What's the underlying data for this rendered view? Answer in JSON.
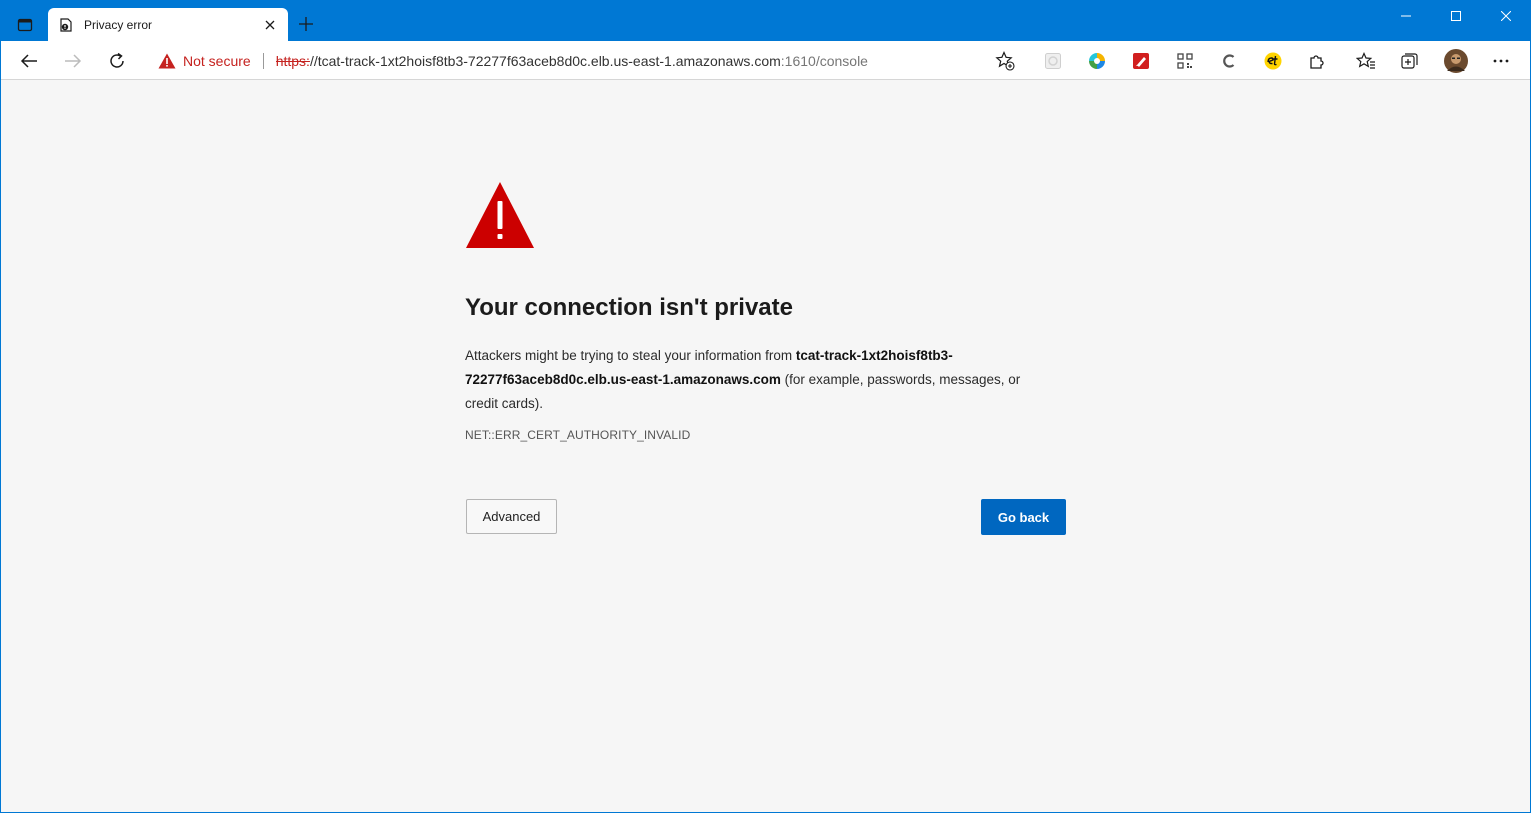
{
  "window": {
    "tab_title": "Privacy error",
    "accent_color": "#0078d4"
  },
  "toolbar": {
    "security_label": "Not secure",
    "url_scheme": "https:",
    "url_sep": "//",
    "url_host": "tcat-track-1xt2hoisf8tb3-72277f63aceb8d0c.elb.us-east-1.amazonaws.com",
    "url_path": ":1610/console",
    "extensions": [
      "extension-grey-icon",
      "extension-colorful-icon",
      "extension-red-pen-icon",
      "extension-qr-icon",
      "extension-c-icon",
      "extension-et-icon",
      "extensions-puzzle-icon",
      "favorites-icon",
      "collections-icon",
      "profile-avatar",
      "more-menu-icon"
    ]
  },
  "error_page": {
    "headline": "Your connection isn't private",
    "message_prefix": "Attackers might be trying to steal your information from ",
    "message_host": "tcat-track-1xt2hoisf8tb3-72277f63aceb8d0c.elb.us-east-1.amazonaws.com",
    "message_suffix": " (for example, passwords, messages, or credit cards).",
    "error_code": "NET::ERR_CERT_AUTHORITY_INVALID",
    "advanced_label": "Advanced",
    "go_back_label": "Go back",
    "warning_color": "#cc0000",
    "primary_button_color": "#0067c0"
  }
}
